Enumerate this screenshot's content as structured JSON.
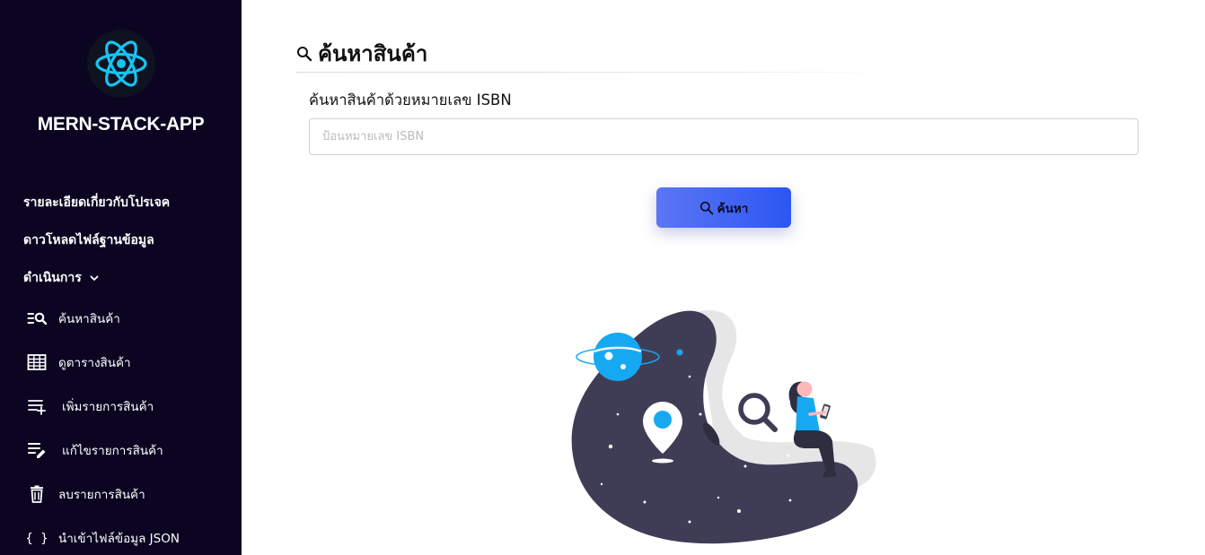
{
  "app": {
    "title": "MERN-STACK-APP",
    "logo_icon": "react-atom-icon",
    "logo_color": "#17c3f2"
  },
  "sidebar": {
    "background": "#0b0522",
    "links": [
      {
        "label": "รายละเอียดเกี่ยวกับโปรเจค"
      },
      {
        "label": "ดาวโหลดไฟล์ฐานข้อมูล"
      },
      {
        "label": "ดำเนินการ",
        "icon": "chevron-down-icon",
        "expanded": true
      }
    ],
    "subitems": [
      {
        "label": "ค้นหาสินค้า",
        "icon": "list-search-icon"
      },
      {
        "label": "ดูตารางสินค้า",
        "icon": "table-grid-icon"
      },
      {
        "label": "เพิ่มรายการสินค้า",
        "icon": "playlist-add-icon"
      },
      {
        "label": "แก้ไขรายการสินค้า",
        "icon": "playlist-edit-icon"
      },
      {
        "label": "ลบรายการสินค้า",
        "icon": "trash-icon"
      },
      {
        "label": "นำเข้าไฟล์ข้อมูล JSON",
        "icon": "braces-icon"
      }
    ]
  },
  "main": {
    "page_title": "ค้นหาสินค้า",
    "title_icon": "search-icon",
    "field_label": "ค้นหาสินค้าด้วยหมายเลข ISBN",
    "input_value": "",
    "input_placeholder": "ป้อนหมายเลข ISBN",
    "button_label": "ค้นหา",
    "button_icon": "search-icon",
    "button_gradient": [
      "#5b76f5",
      "#2c56f2"
    ],
    "illustration": "woman-reading-phone-on-planet-illustration"
  }
}
